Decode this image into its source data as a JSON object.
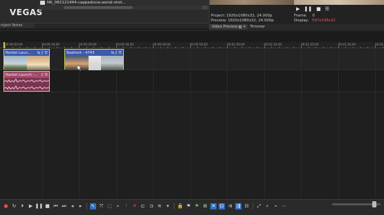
{
  "app": {
    "logo": "VEGAS"
  },
  "media": {
    "file_name": "NK_082121444-cappadocia-aerial-shot..."
  },
  "tabs": {
    "project_notes": "roject Notes"
  },
  "preview": {
    "project_label": "Project:",
    "project_value": "1920x1080x32, 24.000p",
    "preview_label": "Preview:",
    "preview_value": "1920x1080x32, 24.000p",
    "frame_label": "Frame:",
    "frame_value": "0",
    "display_label": "Display:",
    "display_value": "597x336x32",
    "tab_video_preview": "Video Preview",
    "tab_trimmer": "Trimmer",
    "transport": [
      "play-icon",
      "pause-icon",
      "stop-icon",
      "menu-icon"
    ]
  },
  "ruler": {
    "labels": [
      "00:00:00;00",
      "00:00:10;00",
      "00:00:20;00",
      "00:00:30;00",
      "00:00:40;00",
      "00:00:50;00",
      "00:01:00;00",
      "00:01:10;00",
      "00:01:20;00",
      "00:01:30;00",
      "00:01:40;00"
    ]
  },
  "clips": {
    "video1_name": "Rocket Laun...",
    "video2_name": "Seafront - 4743",
    "audio1_name": "Rocket Launch -..."
  },
  "colors": {
    "video_header": "#3d5aa8",
    "audio_header": "#a24a6a",
    "clip_border": "#c8d45a",
    "display_value": "#e06060"
  }
}
